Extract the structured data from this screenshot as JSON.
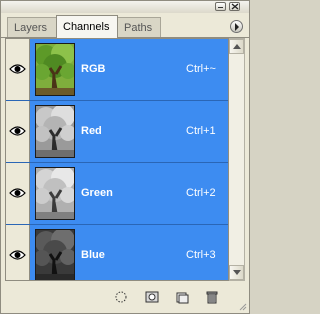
{
  "tabs": [
    {
      "label": "Layers"
    },
    {
      "label": "Channels",
      "active": true
    },
    {
      "label": "Paths"
    }
  ],
  "channels": [
    {
      "name": "RGB",
      "shortcut": "Ctrl+~",
      "visible": true,
      "thumb": "color"
    },
    {
      "name": "Red",
      "shortcut": "Ctrl+1",
      "visible": true,
      "thumb": "gray-light"
    },
    {
      "name": "Green",
      "shortcut": "Ctrl+2",
      "visible": true,
      "thumb": "gray-mid"
    },
    {
      "name": "Blue",
      "shortcut": "Ctrl+3",
      "visible": true,
      "thumb": "gray-dark"
    }
  ],
  "colors": {
    "selection": "#3d8cf1",
    "panel_bg": "#ece9d8"
  },
  "bottom_icons": [
    "load-selection-icon",
    "save-selection-icon",
    "new-channel-icon",
    "delete-channel-icon"
  ]
}
